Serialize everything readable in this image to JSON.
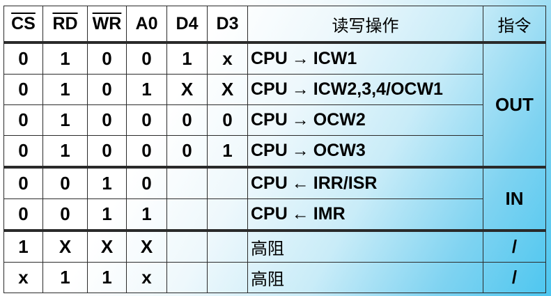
{
  "header": {
    "cs": "CS",
    "rd": "RD",
    "wr": "WR",
    "a0": "A0",
    "d4": "D4",
    "d3": "D3",
    "operation": "读写操作",
    "instruction": "指令"
  },
  "rows": [
    {
      "cs": "0",
      "rd": "1",
      "wr": "0",
      "a0": "0",
      "d4": "1",
      "d3": "x",
      "src": "CPU",
      "arrow": "→",
      "dst": "ICW1"
    },
    {
      "cs": "0",
      "rd": "1",
      "wr": "0",
      "a0": "1",
      "d4": "X",
      "d3": "X",
      "src": "CPU",
      "arrow": "→",
      "dst": "ICW2,3,4/OCW1"
    },
    {
      "cs": "0",
      "rd": "1",
      "wr": "0",
      "a0": "0",
      "d4": "0",
      "d3": "0",
      "src": "CPU",
      "arrow": "→",
      "dst": "OCW2"
    },
    {
      "cs": "0",
      "rd": "1",
      "wr": "0",
      "a0": "0",
      "d4": "0",
      "d3": "1",
      "src": "CPU",
      "arrow": "→",
      "dst": "OCW3"
    },
    {
      "cs": "0",
      "rd": "0",
      "wr": "1",
      "a0": "0",
      "d4": "",
      "d3": "",
      "src": "CPU",
      "arrow": "←",
      "dst": "IRR/ISR"
    },
    {
      "cs": "0",
      "rd": "0",
      "wr": "1",
      "a0": "1",
      "d4": "",
      "d3": "",
      "src": "CPU",
      "arrow": "←",
      "dst": "IMR"
    },
    {
      "cs": "1",
      "rd": "X",
      "wr": "X",
      "a0": "X",
      "d4": "",
      "d3": "",
      "op": "高阻"
    },
    {
      "cs": "x",
      "rd": "1",
      "wr": "1",
      "a0": "x",
      "d4": "",
      "d3": "",
      "op": "高阻"
    }
  ],
  "instructions": {
    "out": "OUT",
    "in": "IN",
    "none1": "/",
    "none2": "/"
  }
}
